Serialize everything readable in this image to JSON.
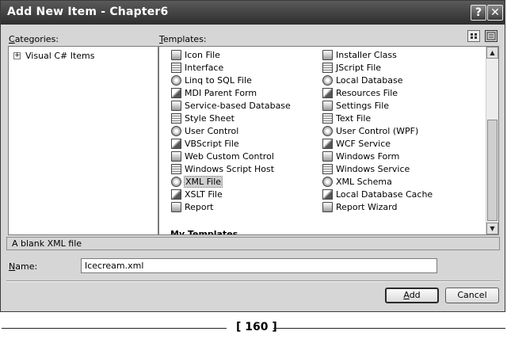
{
  "window": {
    "title": "Add New Item - Chapter6",
    "help_label": "?",
    "close_label": "✕"
  },
  "labels": {
    "categories": "Categories:",
    "templates": "Templates:",
    "name": "Name:"
  },
  "categories": [
    {
      "label": "Visual C# Items",
      "expander": "+"
    }
  ],
  "templates": {
    "left_column": [
      {
        "label": "Icon File",
        "icon": "icon-file-icon"
      },
      {
        "label": "Interface",
        "icon": "interface-icon"
      },
      {
        "label": "Linq to SQL File",
        "icon": "linq-icon"
      },
      {
        "label": "MDI Parent Form",
        "icon": "form-icon"
      },
      {
        "label": "Service-based Database",
        "icon": "database-icon"
      },
      {
        "label": "Style Sheet",
        "icon": "stylesheet-icon"
      },
      {
        "label": "User Control",
        "icon": "user-control-icon"
      },
      {
        "label": "VBScript File",
        "icon": "script-icon"
      },
      {
        "label": "Web Custom Control",
        "icon": "web-control-icon"
      },
      {
        "label": "Windows Script Host",
        "icon": "script-host-icon"
      },
      {
        "label": "XML File",
        "icon": "xml-file-icon",
        "selected": true
      },
      {
        "label": "XSLT File",
        "icon": "xslt-icon"
      },
      {
        "label": "Report",
        "icon": "report-icon"
      }
    ],
    "right_column": [
      {
        "label": "Installer Class",
        "icon": "installer-icon"
      },
      {
        "label": "JScript File",
        "icon": "script-icon"
      },
      {
        "label": "Local Database",
        "icon": "database-icon"
      },
      {
        "label": "Resources File",
        "icon": "resources-icon"
      },
      {
        "label": "Settings File",
        "icon": "settings-icon"
      },
      {
        "label": "Text File",
        "icon": "text-file-icon"
      },
      {
        "label": "User Control (WPF)",
        "icon": "wpf-control-icon"
      },
      {
        "label": "WCF Service",
        "icon": "wcf-icon"
      },
      {
        "label": "Windows Form",
        "icon": "form-icon"
      },
      {
        "label": "Windows Service",
        "icon": "service-icon"
      },
      {
        "label": "XML Schema",
        "icon": "schema-icon"
      },
      {
        "label": "Local Database Cache",
        "icon": "cache-icon"
      },
      {
        "label": "Report Wizard",
        "icon": "wizard-icon"
      }
    ],
    "section_header": "My Templates"
  },
  "description": "A blank XML file",
  "name_field": {
    "value": "Icecream.xml"
  },
  "buttons": {
    "add": "Add",
    "cancel": "Cancel"
  },
  "footer": {
    "page": "[ 160 ]"
  }
}
